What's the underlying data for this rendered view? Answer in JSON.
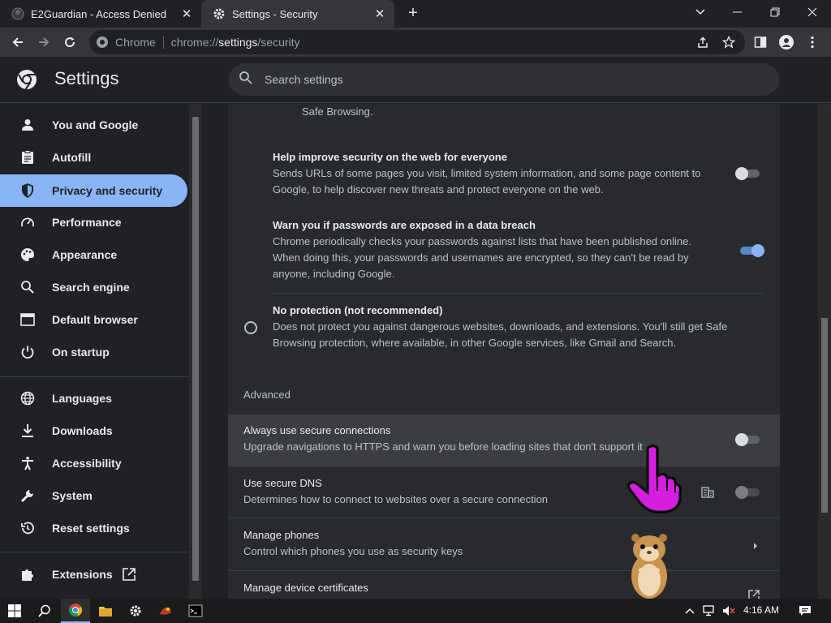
{
  "tabs": [
    {
      "title": "E2Guardian - Access Denied",
      "active": false
    },
    {
      "title": "Settings - Security",
      "active": true
    }
  ],
  "omnibox": {
    "chip": "Chrome",
    "url_scheme": "chrome://",
    "url_host": "settings",
    "url_path": "/security"
  },
  "header": {
    "title": "Settings",
    "search_placeholder": "Search settings"
  },
  "sidebar": {
    "items": [
      {
        "label": "You and Google",
        "icon": "person-icon"
      },
      {
        "label": "Autofill",
        "icon": "clipboard-icon"
      },
      {
        "label": "Privacy and security",
        "icon": "shield-icon",
        "selected": true
      },
      {
        "label": "Performance",
        "icon": "speedometer-icon"
      },
      {
        "label": "Appearance",
        "icon": "palette-icon"
      },
      {
        "label": "Search engine",
        "icon": "search-icon"
      },
      {
        "label": "Default browser",
        "icon": "browser-icon"
      },
      {
        "label": "On startup",
        "icon": "power-icon"
      },
      {
        "label": "Languages",
        "icon": "globe-icon"
      },
      {
        "label": "Downloads",
        "icon": "download-icon"
      },
      {
        "label": "Accessibility",
        "icon": "accessibility-icon"
      },
      {
        "label": "System",
        "icon": "wrench-icon"
      },
      {
        "label": "Reset settings",
        "icon": "history-icon"
      },
      {
        "label": "Extensions",
        "icon": "puzzle-icon"
      }
    ]
  },
  "content": {
    "safe_browsing_tail": "Safe Browsing.",
    "help_improve": {
      "title": "Help improve security on the web for everyone",
      "desc1": "Sends URLs of some pages you visit, limited system information, and some page content to",
      "desc2": "Google, to help discover new threats and protect everyone on the web.",
      "enabled": false
    },
    "password_breach": {
      "title": "Warn you if passwords are exposed in a data breach",
      "desc1": "Chrome periodically checks your passwords against lists that have been published online.",
      "desc2": "When doing this, your passwords and usernames are encrypted, so they can't be read by",
      "desc3": "anyone, including Google.",
      "enabled": true
    },
    "no_protection": {
      "title": "No protection (not recommended)",
      "desc1": "Does not protect you against dangerous websites, downloads, and extensions. You'll still get Safe",
      "desc2": "Browsing protection, where available, in other Google services, like Gmail and Search."
    },
    "advanced_heading": "Advanced",
    "secure_connections": {
      "title": "Always use secure connections",
      "desc": "Upgrade navigations to HTTPS and warn you before loading sites that don't support it",
      "enabled": false
    },
    "secure_dns": {
      "title": "Use secure DNS",
      "desc": "Determines how to connect to websites over a secure connection",
      "enabled": false
    },
    "manage_phones": {
      "title": "Manage phones",
      "desc": "Control which phones you use as security keys"
    },
    "manage_certs": {
      "title": "Manage device certificates"
    }
  },
  "taskbar": {
    "time": "4:16 AM"
  },
  "colors": {
    "accent": "#8ab4f8",
    "background": "#202124",
    "card": "#292a2d"
  }
}
